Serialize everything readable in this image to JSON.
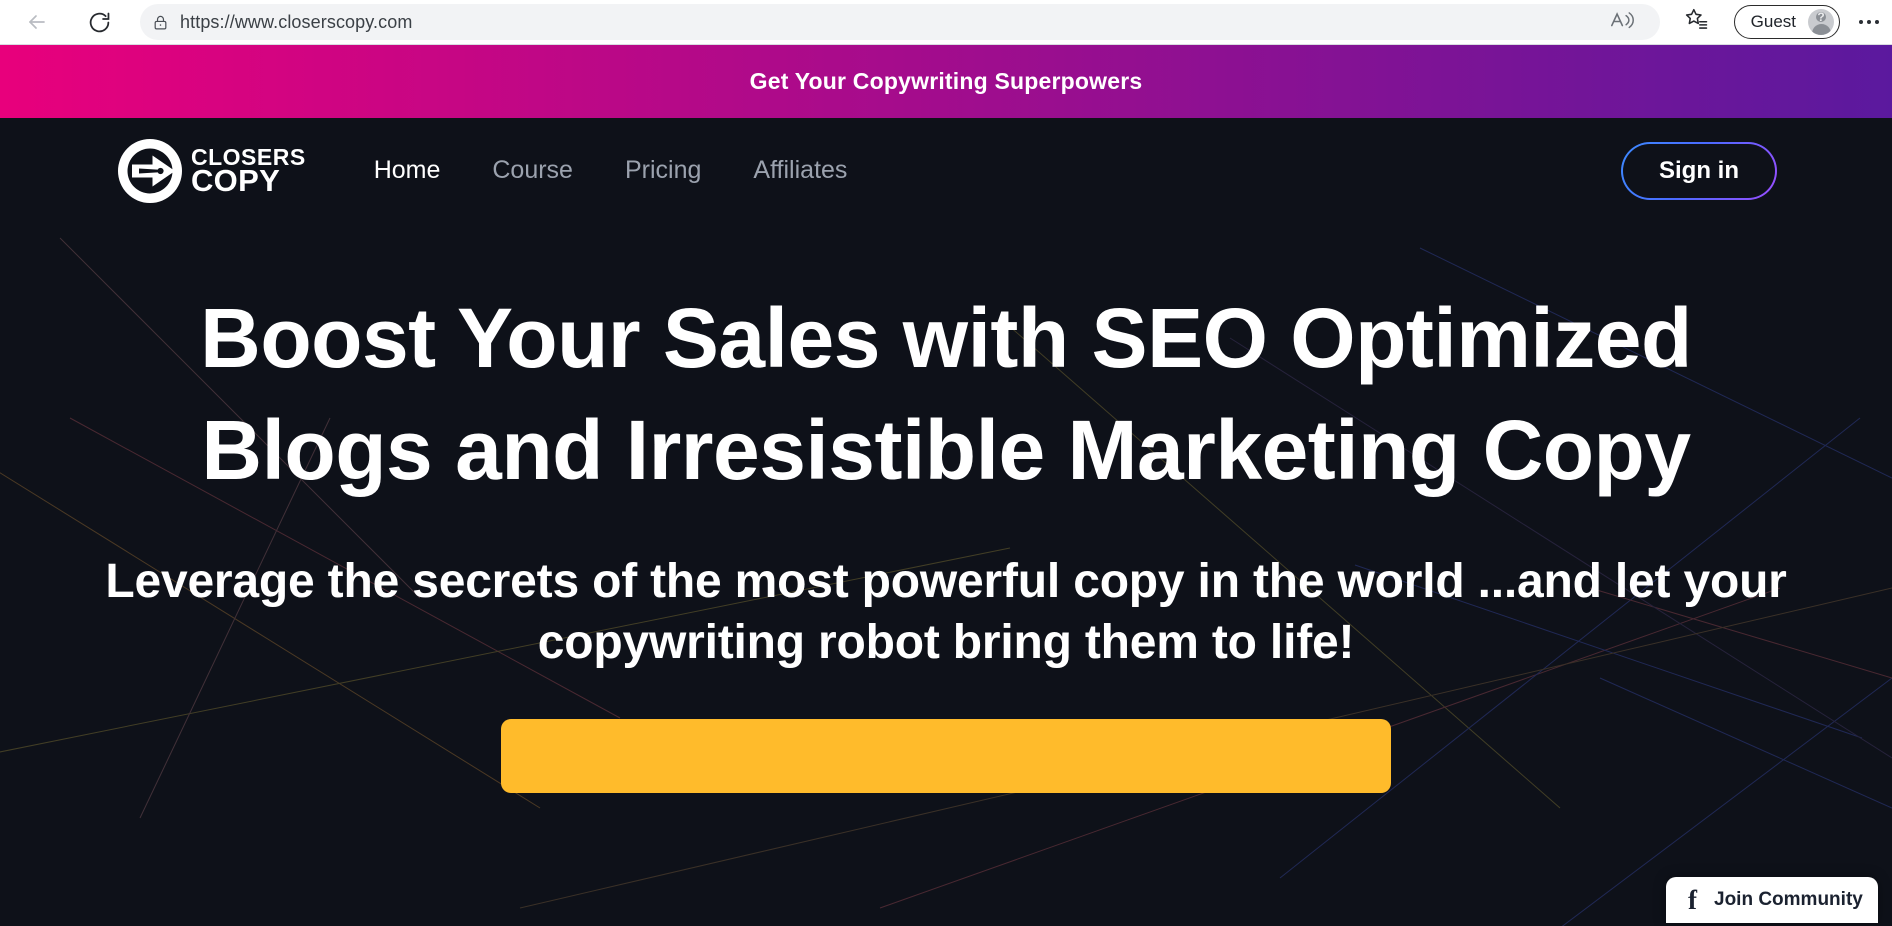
{
  "browser": {
    "url": "https://www.closerscopy.com",
    "back_label": "Back",
    "reload_label": "Refresh",
    "lock_icon": "lock-icon",
    "back_icon": "arrow-left-icon",
    "reload_icon": "reload-icon",
    "read_aloud_icon": "read-aloud-icon",
    "favorites_icon": "favorites-star-icon",
    "settings_icon": "more-options-icon",
    "profile": {
      "label": "Guest",
      "avatar_icon": "guest-avatar-icon",
      "avatar_badge": "?"
    }
  },
  "promo": {
    "text": "Get Your Copywriting Superpowers",
    "gradient_from": "#e8007c",
    "gradient_to": "#5b199e"
  },
  "site": {
    "logo": {
      "icon": "closerscopy-pen-logo-icon",
      "line1": "CLOSERS",
      "line2": "COPY"
    },
    "nav": [
      {
        "label": "Home",
        "active": true
      },
      {
        "label": "Course",
        "active": false
      },
      {
        "label": "Pricing",
        "active": false
      },
      {
        "label": "Affiliates",
        "active": false
      }
    ],
    "signin_label": "Sign in",
    "signin_border_from": "#3d8bff",
    "signin_border_to": "#9b4dff"
  },
  "hero": {
    "headline": "Boost Your Sales with SEO Optimized Blogs and Irresistible Marketing Copy",
    "subheadline": "Leverage the secrets of the most powerful copy in the world ...and let your copywriting robot bring them to life!",
    "cta_label": "",
    "cta_color": "#ffbb2b"
  },
  "facebook_widget": {
    "icon": "facebook-f-icon",
    "glyph": "f",
    "label": "Join Community"
  },
  "theme": {
    "page_background": "#0e1119",
    "text_primary": "#ffffff",
    "nav_inactive": "#9ba2ae"
  }
}
